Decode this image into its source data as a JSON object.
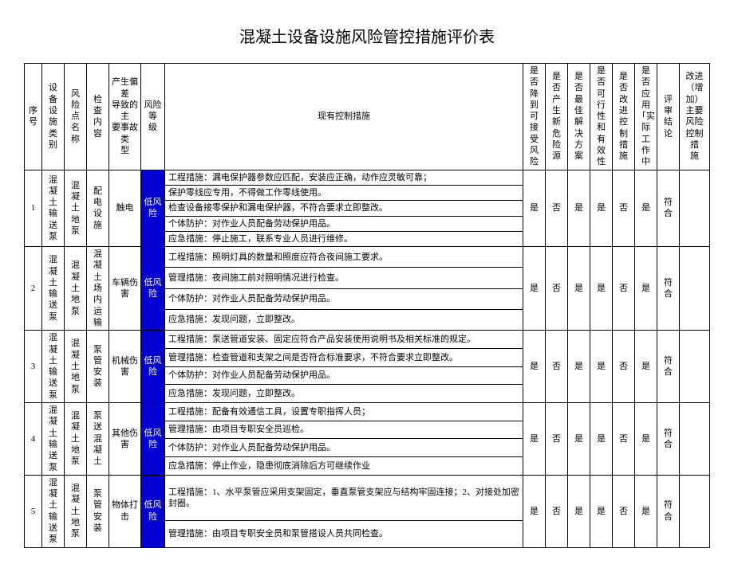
{
  "title": "混凝土设备设施风险管控措施评价表",
  "headers": {
    "seq": "序号",
    "category": "设 备\n设 施类\n别",
    "risk_point": "风险点\n名称",
    "check": "检查\n内容",
    "cause": "产生偏差\n导致的主\n要事故类\n型",
    "risk_level": "风险等\n级",
    "measures": "现有控制措施",
    "q1": "是否降\n到可接\n受风险",
    "q2": "是否产\n生新危\n险源",
    "q3": "是否最\n佳解决\n方案",
    "q4": "是否可\n行性和\n有效性",
    "q5": "是否改\n进控制\n措施",
    "q6": "是否应\n用\n「实际\n工作中",
    "verdict": "评审\n结论",
    "improve": "改进\n（增加）\n主要风险\n控制措\n施"
  },
  "rows": [
    {
      "seq": "1",
      "category": "混凝\n土输\n送泵",
      "risk_point": "混凝\n土地\n泵",
      "check": "配电\n设施",
      "cause": "触电",
      "risk_level": "低风险",
      "measures": [
        "工程措施：漏电保护器参数应匹配，安装应正确，动作应灵敏可靠；",
        "保护零线应专用，不得做工作零线使用。",
        "检查设备接零保护和漏电保护器，不符合要求立即整改。",
        "个体防护：对作业人员配备劳动保护用品。",
        "应急措施：停止施工，联系专业人员进行维修。"
      ],
      "q1": "是",
      "q2": "否",
      "q3": "是",
      "q4": "是",
      "q5": "否",
      "q6": "是",
      "verdict": "符合",
      "improve": ""
    },
    {
      "seq": "2",
      "category": "混凝\n土输\n送泵",
      "risk_point": "混凝\n土地\n泵",
      "check": "混凝\n土场\n内运\n输",
      "cause": "车辆伤\n害",
      "risk_level": "低风\n险",
      "measures": [
        "工程措施：照明灯具的数量和照度应符合夜间施工要求。",
        "管理措施：夜间施工前对照明情况进行检查。",
        "个体防护：对作业人员配备劳动保护用品。",
        "应急措施：发现问题，立即整改。"
      ],
      "q1": "是",
      "q2": "否",
      "q3": "是",
      "q4": "是",
      "q5": "否",
      "q6": "是",
      "verdict": "符\n合",
      "improve": ""
    },
    {
      "seq": "3",
      "category": "混凝\n土输\n送泵",
      "risk_point": "混凝\n土地\n泵",
      "check": "泵管\n安装",
      "cause": "机械伤\n害",
      "risk_level": "低风\n险",
      "measures": [
        "工程措施：泵送管道安装、固定应符合产品安装使用说明书及相关标准的规定。",
        "管理措施：检查管道和支架之间是否符合标准要求，不符合要求立即整改。",
        "个体防护：对作业人员配备劳动保护用品。",
        "应急措施：发现问题，立即整改。"
      ],
      "q1": "是",
      "q2": "否",
      "q3": "是",
      "q4": "是",
      "q5": "否",
      "q6": "是",
      "verdict": "符\n合",
      "improve": ""
    },
    {
      "seq": "4",
      "category": "混凝\n土输\n送泵",
      "risk_point": "混凝\n土地\n泵",
      "check": "泵送\n混凝\n土",
      "cause": "其他伤\n害",
      "risk_level": "低风\n险",
      "measures": [
        "工程措施：配备有效通信工具，设置专职指挥人员；",
        "管理措施：由项目专职安全员巡检。",
        "个体防护：对作业人员配备劳动保护用品。",
        "应急措施：停止作业，隐患彻底消除后方可继续作业"
      ],
      "q1": "是",
      "q2": "否",
      "q3": "是",
      "q4": "是",
      "q5": "否",
      "q6": "是",
      "verdict": "符\n合",
      "improve": ""
    },
    {
      "seq": "5",
      "category": "混凝\n土输\n送泵",
      "risk_point": "混凝\n土地\n泵",
      "check": "泵管\n安装",
      "cause": "物体打击",
      "risk_level": "低风\n险",
      "measures": [
        "工程措施：1、水平泵管应采用支架固定，垂直泵管支架应与结构牢固连接；2、对接处加密封圈。",
        "管理措施：由项目专职安全员和泵管搭设人员共同检查。"
      ],
      "q1": "是",
      "q2": "否",
      "q3": "是",
      "q4": "是",
      "q5": "否",
      "q6": "是",
      "verdict": "符合",
      "improve": ""
    }
  ]
}
